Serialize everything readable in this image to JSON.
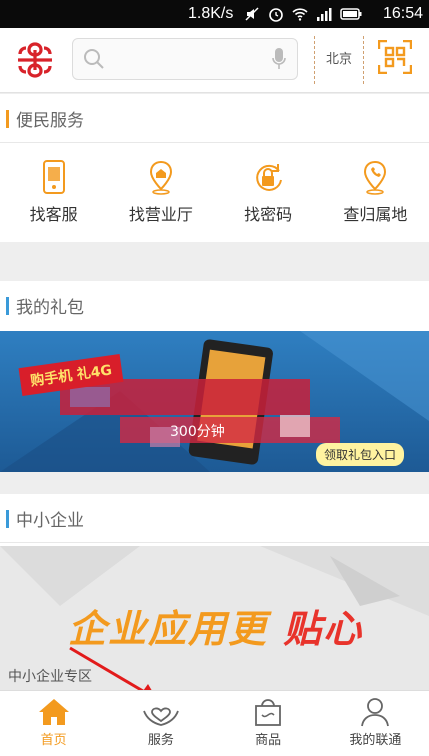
{
  "status_bar": {
    "speed": "1.8K/s",
    "time": "16:54"
  },
  "search": {
    "placeholder": ""
  },
  "city": "北京",
  "sections": [
    {
      "title": "便民服务",
      "accent": "#f39a1e"
    },
    {
      "title": "我的礼包",
      "accent": "#3a9ad9"
    },
    {
      "title": "中小企业",
      "accent": "#3a9ad9"
    }
  ],
  "services": [
    {
      "label": "找客服",
      "icon": "phone-icon"
    },
    {
      "label": "找营业厅",
      "icon": "map-pin-icon"
    },
    {
      "label": "找密码",
      "icon": "lock-icon"
    },
    {
      "label": "查归属地",
      "icon": "location-phone-icon"
    }
  ],
  "gift_banner": {
    "strip": "购手机 礼4G",
    "price": "300分钟",
    "button": "领取礼包入口"
  },
  "enterprise_banner": {
    "slogan_part1": "企业应用更",
    "slogan_part2": "贴心",
    "zone": "中小企业专区"
  },
  "tabs": [
    {
      "label": "首页",
      "icon": "home-icon",
      "active": true
    },
    {
      "label": "服务",
      "icon": "service-heart-icon",
      "active": false
    },
    {
      "label": "商品",
      "icon": "shopping-bag-icon",
      "active": false
    },
    {
      "label": "我的联通",
      "icon": "person-icon",
      "active": false
    }
  ],
  "colors": {
    "orange": "#f39a1e",
    "blue": "#3a9ad9",
    "red": "#e8332b"
  }
}
